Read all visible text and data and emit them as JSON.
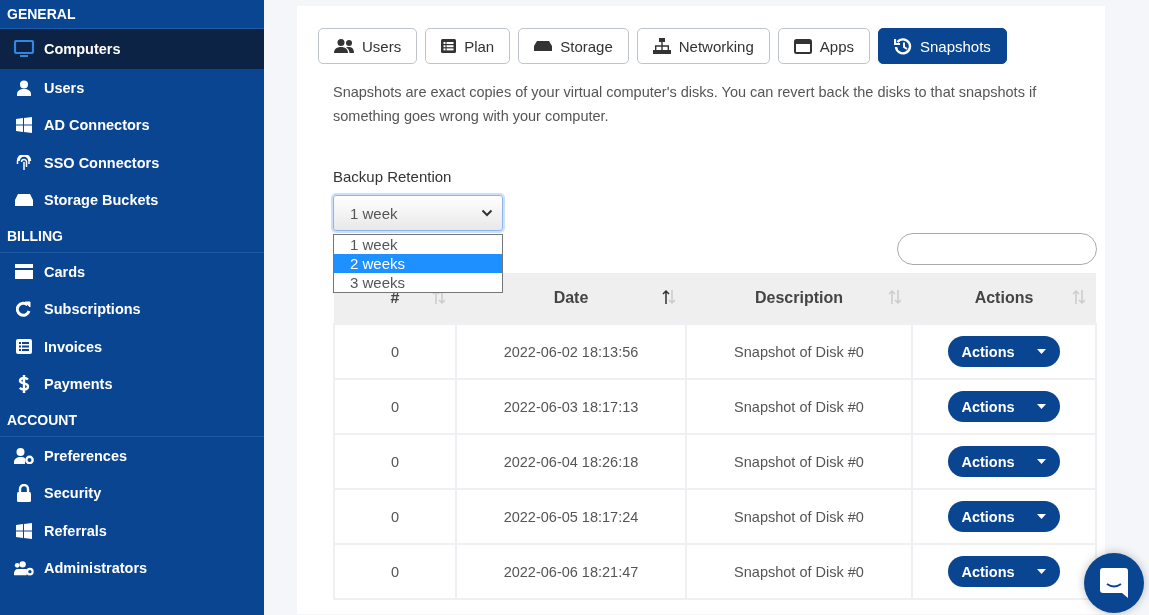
{
  "sidebar": {
    "sections": [
      {
        "title": "GENERAL",
        "items": [
          {
            "label": "Computers",
            "selected": true
          },
          {
            "label": "Users",
            "selected": false
          },
          {
            "label": "AD Connectors",
            "selected": false
          },
          {
            "label": "SSO Connectors",
            "selected": false
          },
          {
            "label": "Storage Buckets",
            "selected": false
          }
        ]
      },
      {
        "title": "BILLING",
        "items": [
          {
            "label": "Cards",
            "selected": false
          },
          {
            "label": "Subscriptions",
            "selected": false
          },
          {
            "label": "Invoices",
            "selected": false
          },
          {
            "label": "Payments",
            "selected": false
          }
        ]
      },
      {
        "title": "ACCOUNT",
        "items": [
          {
            "label": "Preferences",
            "selected": false
          },
          {
            "label": "Security",
            "selected": false
          },
          {
            "label": "Referrals",
            "selected": false
          },
          {
            "label": "Administrators",
            "selected": false
          }
        ]
      }
    ]
  },
  "tabs": [
    {
      "label": "Users",
      "selected": false
    },
    {
      "label": "Plan",
      "selected": false
    },
    {
      "label": "Storage",
      "selected": false
    },
    {
      "label": "Networking",
      "selected": false
    },
    {
      "label": "Apps",
      "selected": false
    },
    {
      "label": "Snapshots",
      "selected": true
    }
  ],
  "description": "Snapshots are exact copies of your virtual computer's disks. You can revert back the disks to that snapshots if something goes wrong with your computer.",
  "retention": {
    "label": "Backup Retention",
    "value": "1 week",
    "expanded": true,
    "options": [
      {
        "label": "1 week",
        "highlighted": false
      },
      {
        "label": "2 weeks",
        "highlighted": true
      },
      {
        "label": "3 weeks",
        "highlighted": false
      }
    ]
  },
  "table": {
    "columns": [
      {
        "label": "#",
        "sorted": false
      },
      {
        "label": "Date",
        "sorted": true
      },
      {
        "label": "Description",
        "sorted": false
      },
      {
        "label": "Actions",
        "sorted": false
      }
    ],
    "rows": [
      {
        "index": "0",
        "date": "2022-06-02 18:13:56",
        "description": "Snapshot of Disk #0",
        "action": "Actions"
      },
      {
        "index": "0",
        "date": "2022-06-03 18:17:13",
        "description": "Snapshot of Disk #0",
        "action": "Actions"
      },
      {
        "index": "0",
        "date": "2022-06-04 18:26:18",
        "description": "Snapshot of Disk #0",
        "action": "Actions"
      },
      {
        "index": "0",
        "date": "2022-06-05 18:17:24",
        "description": "Snapshot of Disk #0",
        "action": "Actions"
      },
      {
        "index": "0",
        "date": "2022-06-06 18:21:47",
        "description": "Snapshot of Disk #0",
        "action": "Actions"
      }
    ]
  }
}
